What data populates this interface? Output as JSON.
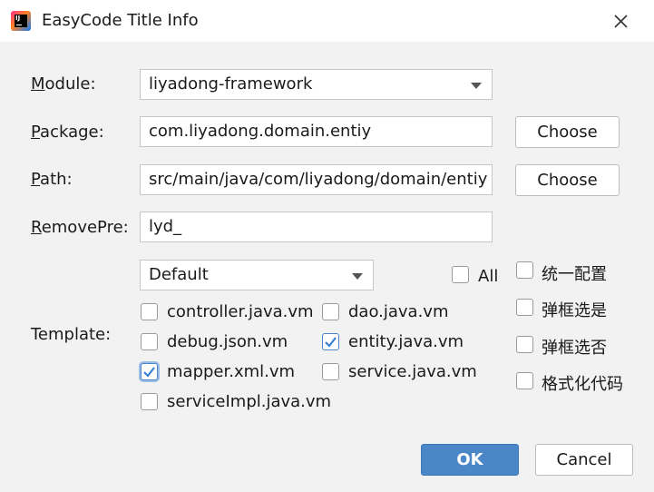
{
  "window": {
    "title": "EasyCode Title Info"
  },
  "form": {
    "module": {
      "label_key": "M",
      "label_rest": "odule:",
      "value": "liyadong-framework"
    },
    "package": {
      "label_key": "P",
      "label_rest": "ackage:",
      "value": "com.liyadong.domain.entiy",
      "button": "Choose"
    },
    "path": {
      "label_key": "P",
      "label_rest": "ath:",
      "value": "src/main/java/com/liyadong/domain/entiy",
      "button": "Choose"
    },
    "removepre": {
      "label_key": "R",
      "label_rest": "emovePre:",
      "value": "lyd_"
    },
    "template": {
      "label": "Template:",
      "group": "Default",
      "all_label": "All",
      "all_checked": false,
      "items": [
        {
          "label": "controller.java.vm",
          "checked": false
        },
        {
          "label": "dao.java.vm",
          "checked": false
        },
        {
          "label": "debug.json.vm",
          "checked": false
        },
        {
          "label": "entity.java.vm",
          "checked": true
        },
        {
          "label": "mapper.xml.vm",
          "checked": true
        },
        {
          "label": "service.java.vm",
          "checked": false
        },
        {
          "label": "serviceImpl.java.vm",
          "checked": false
        }
      ]
    },
    "options": [
      {
        "label": "统一配置",
        "checked": false
      },
      {
        "label": "弹框选是",
        "checked": false
      },
      {
        "label": "弹框选否",
        "checked": false
      },
      {
        "label": "格式化代码",
        "checked": false
      }
    ]
  },
  "footer": {
    "ok": "OK",
    "cancel": "Cancel"
  },
  "colors": {
    "accent": "#4a86c8",
    "background": "#f2f2f2"
  }
}
